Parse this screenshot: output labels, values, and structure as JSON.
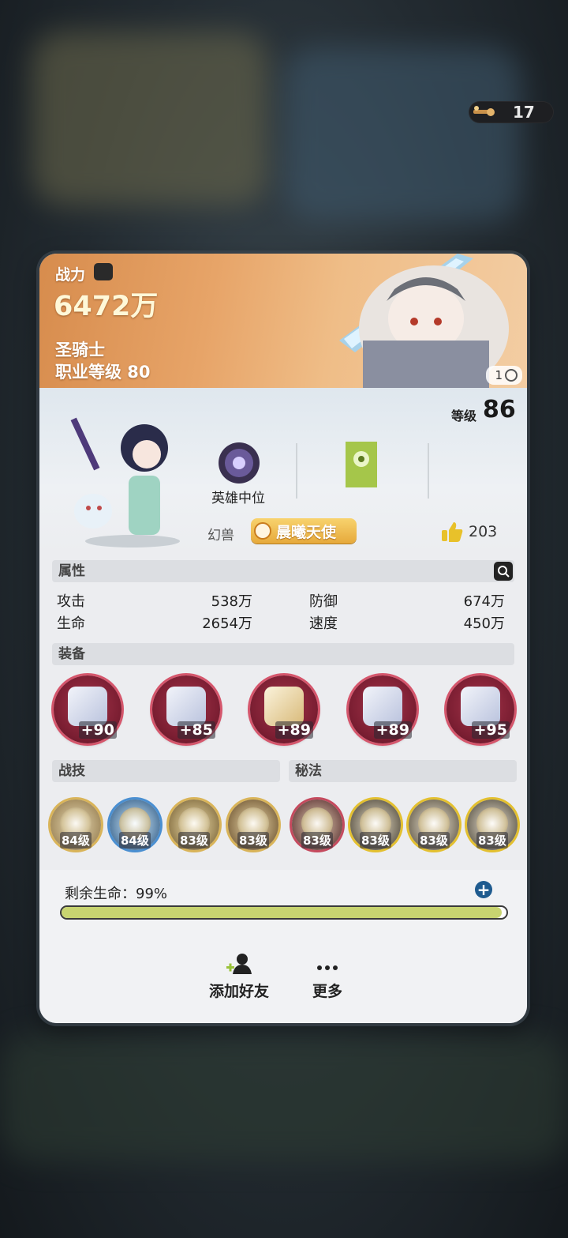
{
  "currency": {
    "amount": "17",
    "icon": "key-item-icon"
  },
  "header": {
    "power_label": "战力",
    "power_value": "6472万",
    "class_name": "圣骑士",
    "class_level": "职业等级 80",
    "page_indicator": "1"
  },
  "profile": {
    "level_label": "等级",
    "level_value": "86",
    "rank_label": "英雄中位",
    "pet_label": "幻兽",
    "title_badge": "晨曦天使",
    "likes": "203"
  },
  "attributes": {
    "section_label": "属性",
    "items": [
      {
        "label": "攻击",
        "value": "538万"
      },
      {
        "label": "防御",
        "value": "674万"
      },
      {
        "label": "生命",
        "value": "2654万"
      },
      {
        "label": "速度",
        "value": "450万"
      }
    ]
  },
  "equipment": {
    "section_label": "装备",
    "items": [
      "+90",
      "+85",
      "+89",
      "+89",
      "+95"
    ]
  },
  "skills": {
    "combat_label": "战技",
    "secret_label": "秘法",
    "items": [
      "84级",
      "84级",
      "83级",
      "83级",
      "83级",
      "83级",
      "83级",
      "83级"
    ]
  },
  "hp": {
    "label": "剩余生命：99%",
    "percent": 99
  },
  "actions": {
    "add_friend": "添加好友",
    "more": "更多"
  }
}
